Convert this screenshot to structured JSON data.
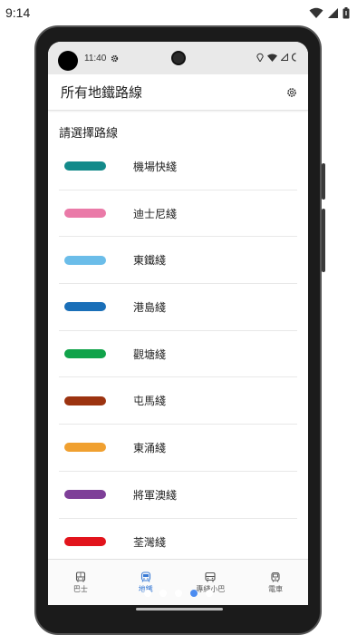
{
  "host_status": {
    "time": "9:14"
  },
  "device_status": {
    "time": "11:40"
  },
  "appbar": {
    "title": "所有地鐵路線"
  },
  "subtitle": "請選擇路線",
  "lines": [
    {
      "name": "機場快綫",
      "color": "#138a8a"
    },
    {
      "name": "迪士尼綫",
      "color": "#ea7aa8"
    },
    {
      "name": "東鐵綫",
      "color": "#6bbde9"
    },
    {
      "name": "港島綫",
      "color": "#1a6fb8"
    },
    {
      "name": "觀塘綫",
      "color": "#10a34a"
    },
    {
      "name": "屯馬綫",
      "color": "#9c3310"
    },
    {
      "name": "東涌綫",
      "color": "#f0a030"
    },
    {
      "name": "將軍澳綫",
      "color": "#7e3f98"
    },
    {
      "name": "荃灣綫",
      "color": "#e2141c"
    }
  ],
  "bottom_nav": [
    {
      "label": "巴士",
      "icon": "bus-icon",
      "active": false
    },
    {
      "label": "地鐵",
      "icon": "metro-icon",
      "active": true
    },
    {
      "label": "專綫小巴",
      "icon": "minibus-icon",
      "active": false
    },
    {
      "label": "電車",
      "icon": "tram-icon",
      "active": false
    }
  ],
  "page_indicator": {
    "count": 5,
    "active_index": 3
  },
  "accent_color": "#3a7bd5"
}
